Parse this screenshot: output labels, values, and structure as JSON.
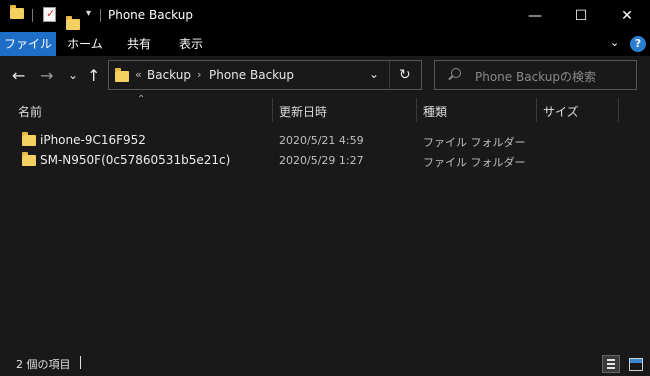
{
  "window": {
    "title": "Phone Backup",
    "minimize_glyph": "—",
    "maximize_glyph": "☐",
    "close_glyph": "✕"
  },
  "ribbon": {
    "tabs": [
      {
        "label": "ファイル"
      },
      {
        "label": "ホーム"
      },
      {
        "label": "共有"
      },
      {
        "label": "表示"
      }
    ],
    "collapse_glyph": "⌄",
    "help_glyph": "?"
  },
  "nav": {
    "back_glyph": "←",
    "forward_glyph": "→",
    "recent_glyph": "⌄",
    "up_glyph": "↑",
    "overflow_glyph": "«",
    "breadcrumb": [
      "Backup",
      "Phone Backup"
    ],
    "crumb_sep": "›",
    "dropdown_glyph": "⌄",
    "refresh_glyph": "↻",
    "search_placeholder": "Phone Backupの検索"
  },
  "columns": {
    "name": "名前",
    "modified": "更新日時",
    "type": "種類",
    "size": "サイズ",
    "sort_glyph": "⌃"
  },
  "files": [
    {
      "name": "iPhone-9C16F952",
      "modified": "2020/5/21 4:59",
      "type": "ファイル フォルダー",
      "size": ""
    },
    {
      "name": "SM-N950F(0c57860531b5e21c)",
      "modified": "2020/5/29 1:27",
      "type": "ファイル フォルダー",
      "size": ""
    }
  ],
  "status": {
    "item_count": "2 個の項目"
  },
  "colors": {
    "accent": "#1e6ec8",
    "folder": "#f4d061",
    "background": "#191919"
  }
}
